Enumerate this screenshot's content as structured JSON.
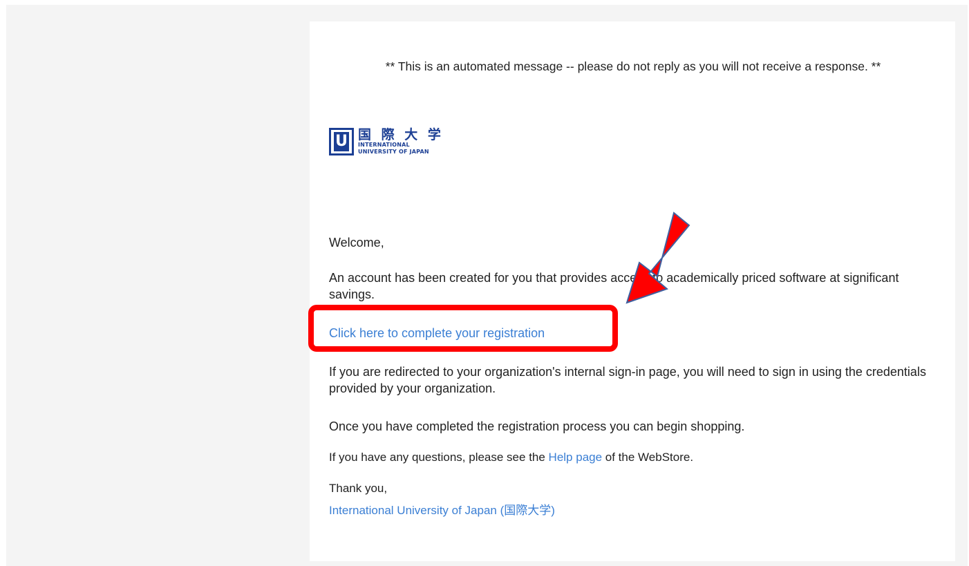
{
  "email": {
    "notice": "** This is an automated message -- please do not reply as you will not receive a response. **",
    "logo": {
      "kanji": "国 際 大 学",
      "line1": "INTERNATIONAL",
      "line2": "UNIVERSITY OF JAPAN",
      "mark": "U"
    },
    "greeting": "Welcome,",
    "intro": "An account has been created for you that provides access to academically priced software at significant savings.",
    "registration_link": "Click here to complete your registration",
    "redirect_note": "If you are redirected to your organization's internal sign-in page, you will need to sign in using the credentials provided by your organization.",
    "shopping_note": "Once you have completed the registration process you can begin shopping.",
    "help_before": "If you have any questions, please see the ",
    "help_link": "Help page",
    "help_after": " of the WebStore.",
    "thanks": "Thank you,",
    "signature_link": "International University of Japan (国際大学)"
  },
  "colors": {
    "link": "#3b7fd4",
    "highlight": "#ff0000",
    "brand": "#1c3f94",
    "background": "#f4f4f4"
  }
}
